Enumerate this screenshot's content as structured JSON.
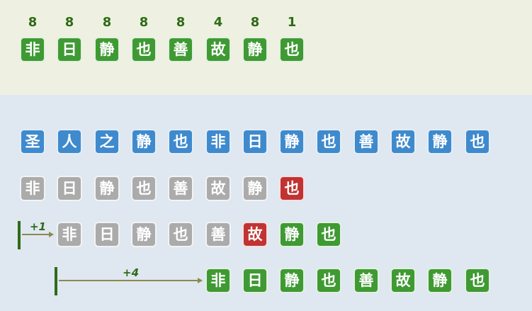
{
  "colors": {
    "top_background": "#eef1e1",
    "bottom_background": "#dfe7f1",
    "green": "#3f9a33",
    "blue": "#3f8acd",
    "gray": "#ababab",
    "red": "#c13333",
    "count_text": "#2f6b16",
    "marker": "#2f6b16",
    "arrow": "#8a8a4a",
    "label": "#2f6b16"
  },
  "top": {
    "pattern": [
      {
        "char": "非",
        "count": "8"
      },
      {
        "char": "日",
        "count": "8"
      },
      {
        "char": "静",
        "count": "8"
      },
      {
        "char": "也",
        "count": "8"
      },
      {
        "char": "善",
        "count": "8"
      },
      {
        "char": "故",
        "count": "4"
      },
      {
        "char": "静",
        "count": "8"
      },
      {
        "char": "也",
        "count": "1"
      }
    ]
  },
  "text_row": [
    "圣",
    "人",
    "之",
    "静",
    "也",
    "非",
    "日",
    "静",
    "也",
    "善",
    "故",
    "静",
    "也"
  ],
  "attempts": [
    {
      "shift": 0,
      "shift_label": "",
      "chars": [
        "非",
        "日",
        "静",
        "也",
        "善",
        "故",
        "静",
        "也"
      ],
      "states": [
        "miss",
        "miss",
        "miss",
        "miss",
        "miss",
        "miss",
        "miss",
        "mismatch"
      ]
    },
    {
      "shift": 1,
      "shift_label": "+1",
      "chars": [
        "非",
        "日",
        "静",
        "也",
        "善",
        "故",
        "静",
        "也"
      ],
      "states": [
        "miss",
        "miss",
        "miss",
        "miss",
        "miss",
        "mismatch",
        "match",
        "match"
      ]
    },
    {
      "shift": 5,
      "shift_label": "+4",
      "chars": [
        "非",
        "日",
        "静",
        "也",
        "善",
        "故",
        "静",
        "也"
      ],
      "states": [
        "match",
        "match",
        "match",
        "match",
        "match",
        "match",
        "match",
        "match"
      ]
    }
  ]
}
